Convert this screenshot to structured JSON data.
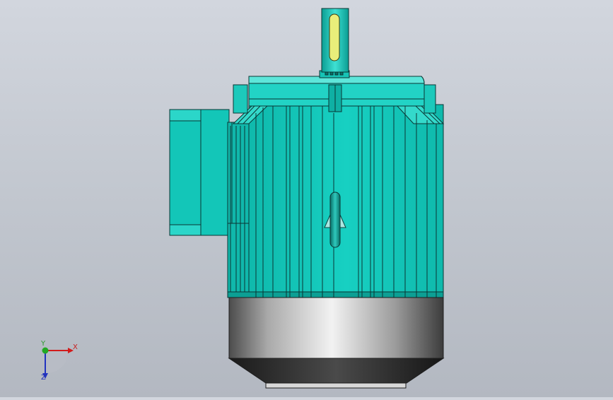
{
  "viewport": {
    "model_icon": "electric-motor",
    "colors": {
      "body": "#12c9bb",
      "body_dark": "#0aa096",
      "body_light": "#4fe0d4",
      "outline": "#0a3634",
      "shaft_key": "#e9ee7a",
      "fan_cover": "#b4b4b4",
      "fan_cover_dark": "#3a3a3a"
    }
  },
  "triad": {
    "x_label": "X",
    "y_label": "Y",
    "z_label": "Z",
    "x_color": "#d21b1b",
    "y_color": "#22a822",
    "z_color": "#2233c0"
  }
}
